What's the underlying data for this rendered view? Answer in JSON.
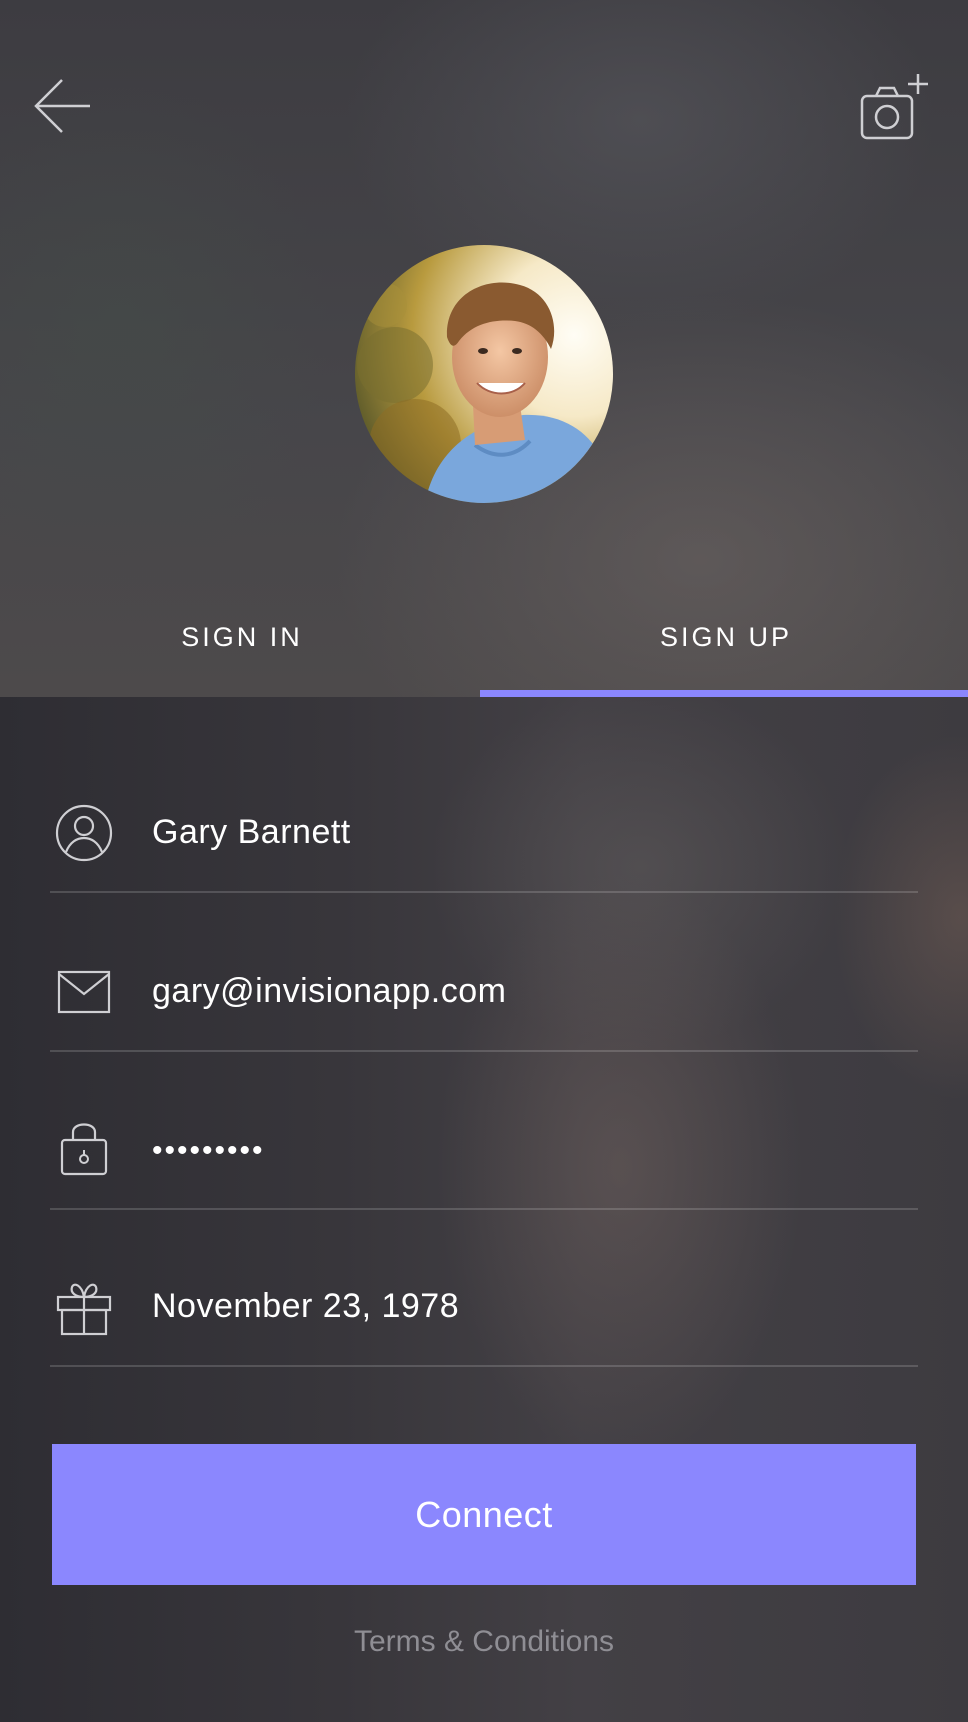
{
  "header": {
    "back_icon": "arrow-left-icon",
    "camera_icon": "camera-add-icon"
  },
  "profile": {
    "avatar_alt": "profile photo"
  },
  "tabs": [
    {
      "label": "SIGN IN",
      "active": false
    },
    {
      "label": "SIGN UP",
      "active": true
    }
  ],
  "form": {
    "name": {
      "icon": "user-icon",
      "value": "Gary Barnett"
    },
    "email": {
      "icon": "envelope-icon",
      "value": "gary@invisionapp.com"
    },
    "password": {
      "icon": "lock-icon",
      "value": "•••••••••"
    },
    "birthday": {
      "icon": "gift-icon",
      "value": "November 23, 1978"
    }
  },
  "actions": {
    "connect_label": "Connect",
    "terms_label": "Terms & Conditions"
  },
  "colors": {
    "accent": "#8b87fe",
    "terms_text": "#8f8e94"
  }
}
